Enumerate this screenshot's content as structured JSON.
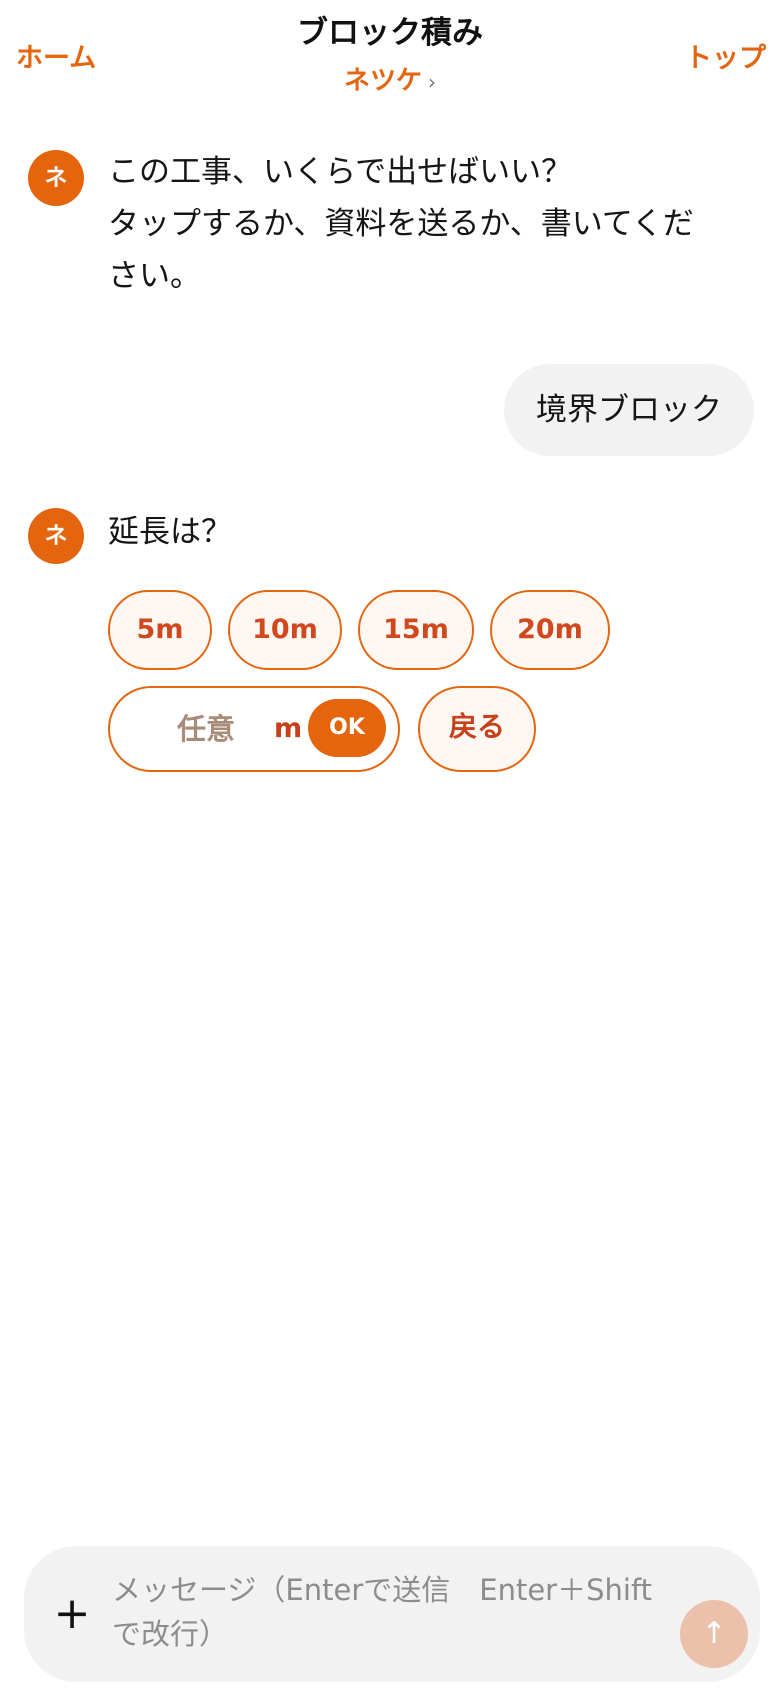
{
  "header": {
    "left_link": "ホーム",
    "title": "ブロック積み",
    "subtitle": "ネツケ",
    "subtitle_chevron": "›",
    "right_link": "トップ"
  },
  "messages": [
    {
      "role": "bot",
      "avatar": "ネ",
      "lines": [
        "この工事、いくらで出せばいい？",
        "タップするか、資料を送るか、書いてくだ",
        "さい。"
      ]
    },
    {
      "role": "user",
      "text": "境界ブロック"
    },
    {
      "role": "bot",
      "avatar": "ネ",
      "lines": [
        "延長は？"
      ]
    }
  ],
  "choices": {
    "options": [
      "5m",
      "10m",
      "15m",
      "20m"
    ],
    "custom": {
      "placeholder": "任意",
      "unit": "m",
      "ok_label": "OK"
    },
    "back_label": "戻る"
  },
  "composer": {
    "plus_icon": "+",
    "placeholder": "メッセージ（Enterで送信　Enter＋Shiftで改行）",
    "send_icon": "↑"
  },
  "colors": {
    "accent": "#e4650d",
    "chip_bg": "#fff7f1",
    "bubble_bg": "#f2f2f2",
    "send_button_disabled": "#ebc1ab"
  },
  "icons": {
    "plus": "plus-icon",
    "send": "arrow-up-icon",
    "chevron": "chevron-right-icon"
  }
}
